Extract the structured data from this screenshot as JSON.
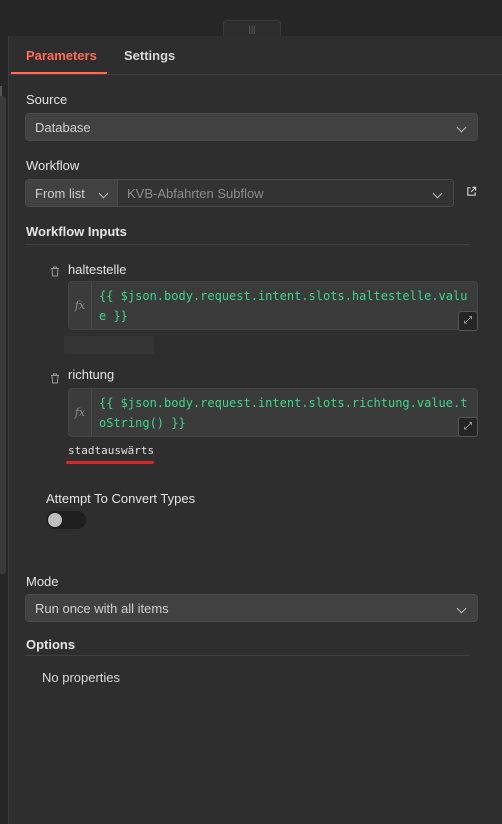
{
  "tabs": {
    "parameters": "Parameters",
    "settings": "Settings"
  },
  "source": {
    "label": "Source",
    "value": "Database"
  },
  "workflow": {
    "label": "Workflow",
    "mode": "From list",
    "value": "KVB-Abfahrten Subflow"
  },
  "workflow_inputs": {
    "label": "Workflow Inputs",
    "items": [
      {
        "name": "haltestelle",
        "expression": "{{ $json.body.request.intent.slots.haltestelle.value }}",
        "result": ""
      },
      {
        "name": "richtung",
        "expression": "{{ $json.body.request.intent.slots.richtung.value.toString() }}",
        "result": "stadtauswärts"
      }
    ]
  },
  "fx_label": "fx",
  "convert_types": {
    "label": "Attempt To Convert Types",
    "enabled": false
  },
  "mode": {
    "label": "Mode",
    "value": "Run once with all items"
  },
  "options": {
    "label": "Options",
    "empty_text": "No properties"
  },
  "colors": {
    "accent": "#ff6d5a",
    "expression_text": "#3ed68c",
    "panel_bg": "#2e2e2f",
    "annotation": "#e32424"
  }
}
